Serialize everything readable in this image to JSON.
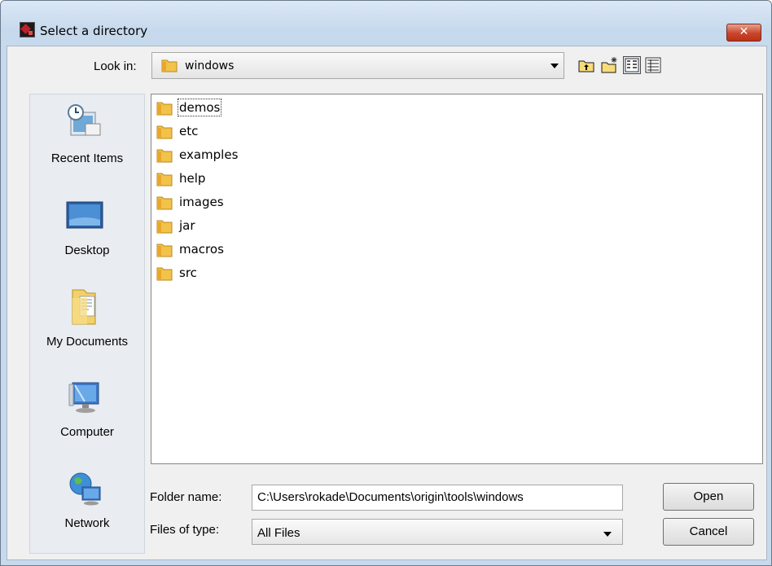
{
  "window": {
    "title": "Select a directory",
    "close_symbol": "✕"
  },
  "lookin": {
    "label": "Look in:",
    "value": "windows"
  },
  "toolbar": {
    "icons": [
      "up-folder-icon",
      "new-folder-icon",
      "list-view-icon",
      "details-view-icon"
    ]
  },
  "places": [
    {
      "label": "Recent Items",
      "icon": "recent-items-icon"
    },
    {
      "label": "Desktop",
      "icon": "desktop-icon"
    },
    {
      "label": "My Documents",
      "icon": "my-documents-icon"
    },
    {
      "label": "Computer",
      "icon": "computer-icon"
    },
    {
      "label": "Network",
      "icon": "network-icon"
    }
  ],
  "files": [
    {
      "name": "demos",
      "focused": true
    },
    {
      "name": "etc"
    },
    {
      "name": "examples"
    },
    {
      "name": "help"
    },
    {
      "name": "images"
    },
    {
      "name": "jar"
    },
    {
      "name": "macros"
    },
    {
      "name": "src"
    }
  ],
  "folder_name": {
    "label": "Folder name:",
    "value": "C:\\Users\\rokade\\Documents\\origin\\tools\\windows"
  },
  "files_of_type": {
    "label": "Files of type:",
    "value": "All Files"
  },
  "buttons": {
    "open": "Open",
    "cancel": "Cancel"
  },
  "colors": {
    "folder": "#f2c24a",
    "close": "#c9452c",
    "title_bar": "#c5d8ec"
  }
}
